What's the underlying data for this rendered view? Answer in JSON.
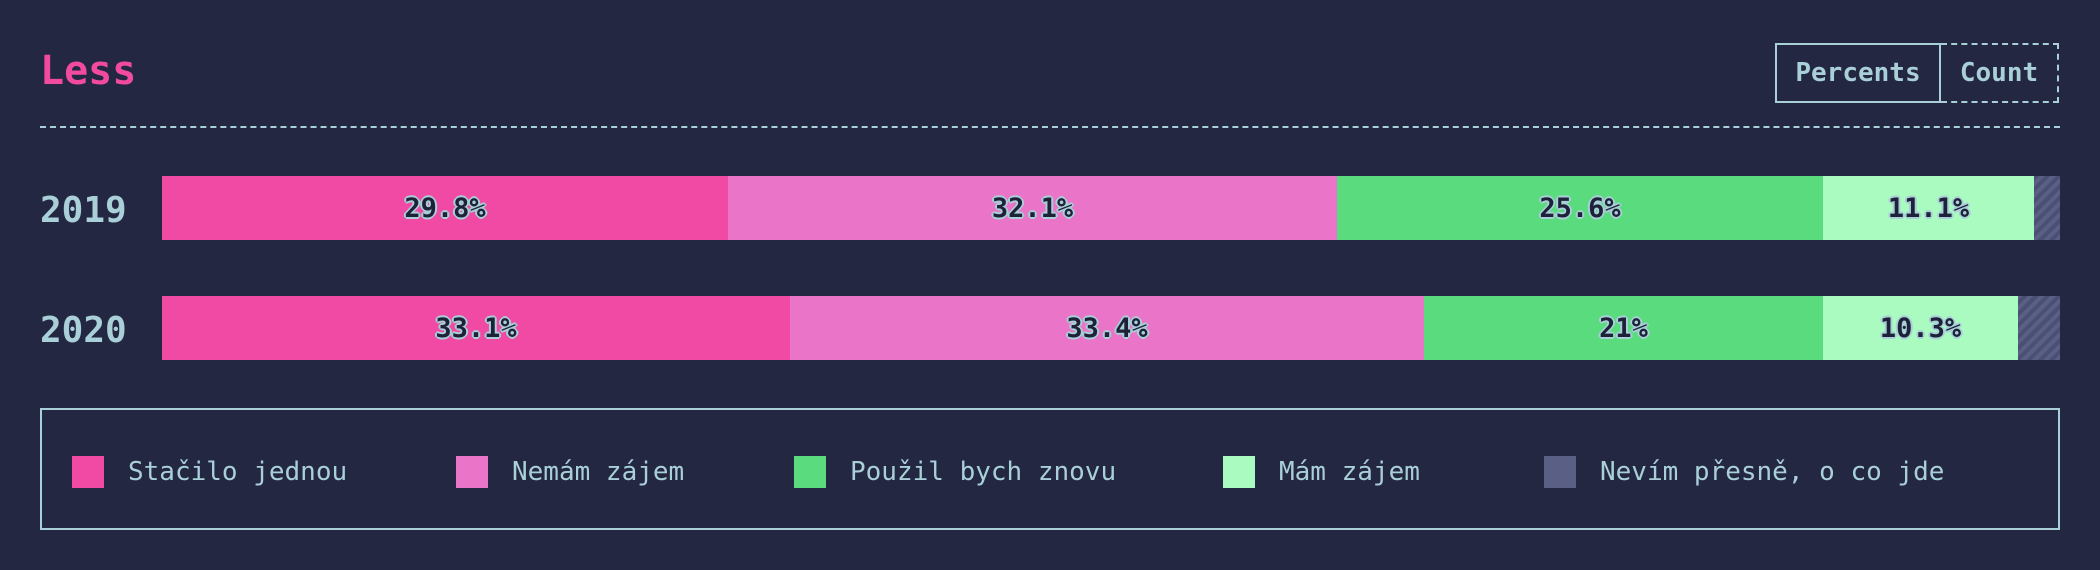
{
  "header": {
    "title": "Less",
    "toggle": {
      "percents_label": "Percents",
      "count_label": "Count",
      "active": "Percents"
    }
  },
  "colors": {
    "background": "#232742",
    "title": "#f14a9e",
    "text": "#a9cfd8",
    "series": [
      "#f14aa4",
      "#ea74c8",
      "#5adc7e",
      "#a9fbc0",
      "#5a5f86"
    ]
  },
  "chart_data": {
    "type": "bar",
    "orientation": "horizontal",
    "stacked": true,
    "normalized": true,
    "title": "Less",
    "categories": [
      "2019",
      "2020"
    ],
    "series": [
      {
        "name": "Stačilo jednou",
        "values": [
          29.8,
          33.1
        ],
        "labels": [
          "29.8%",
          "33.1%"
        ]
      },
      {
        "name": "Nemám zájem",
        "values": [
          32.1,
          33.4
        ],
        "labels": [
          "32.1%",
          "33.4%"
        ]
      },
      {
        "name": "Použil bych znovu",
        "values": [
          25.6,
          21
        ],
        "labels": [
          "25.6%",
          "21%"
        ]
      },
      {
        "name": "Mám zájem",
        "values": [
          11.1,
          10.3
        ],
        "labels": [
          "11.1%",
          "10.3%"
        ]
      },
      {
        "name": "Nevím přesně, o co jde",
        "values": [
          1.4,
          2.2
        ],
        "labels": [
          "",
          ""
        ]
      }
    ],
    "legend_position": "bottom",
    "grid": false
  }
}
